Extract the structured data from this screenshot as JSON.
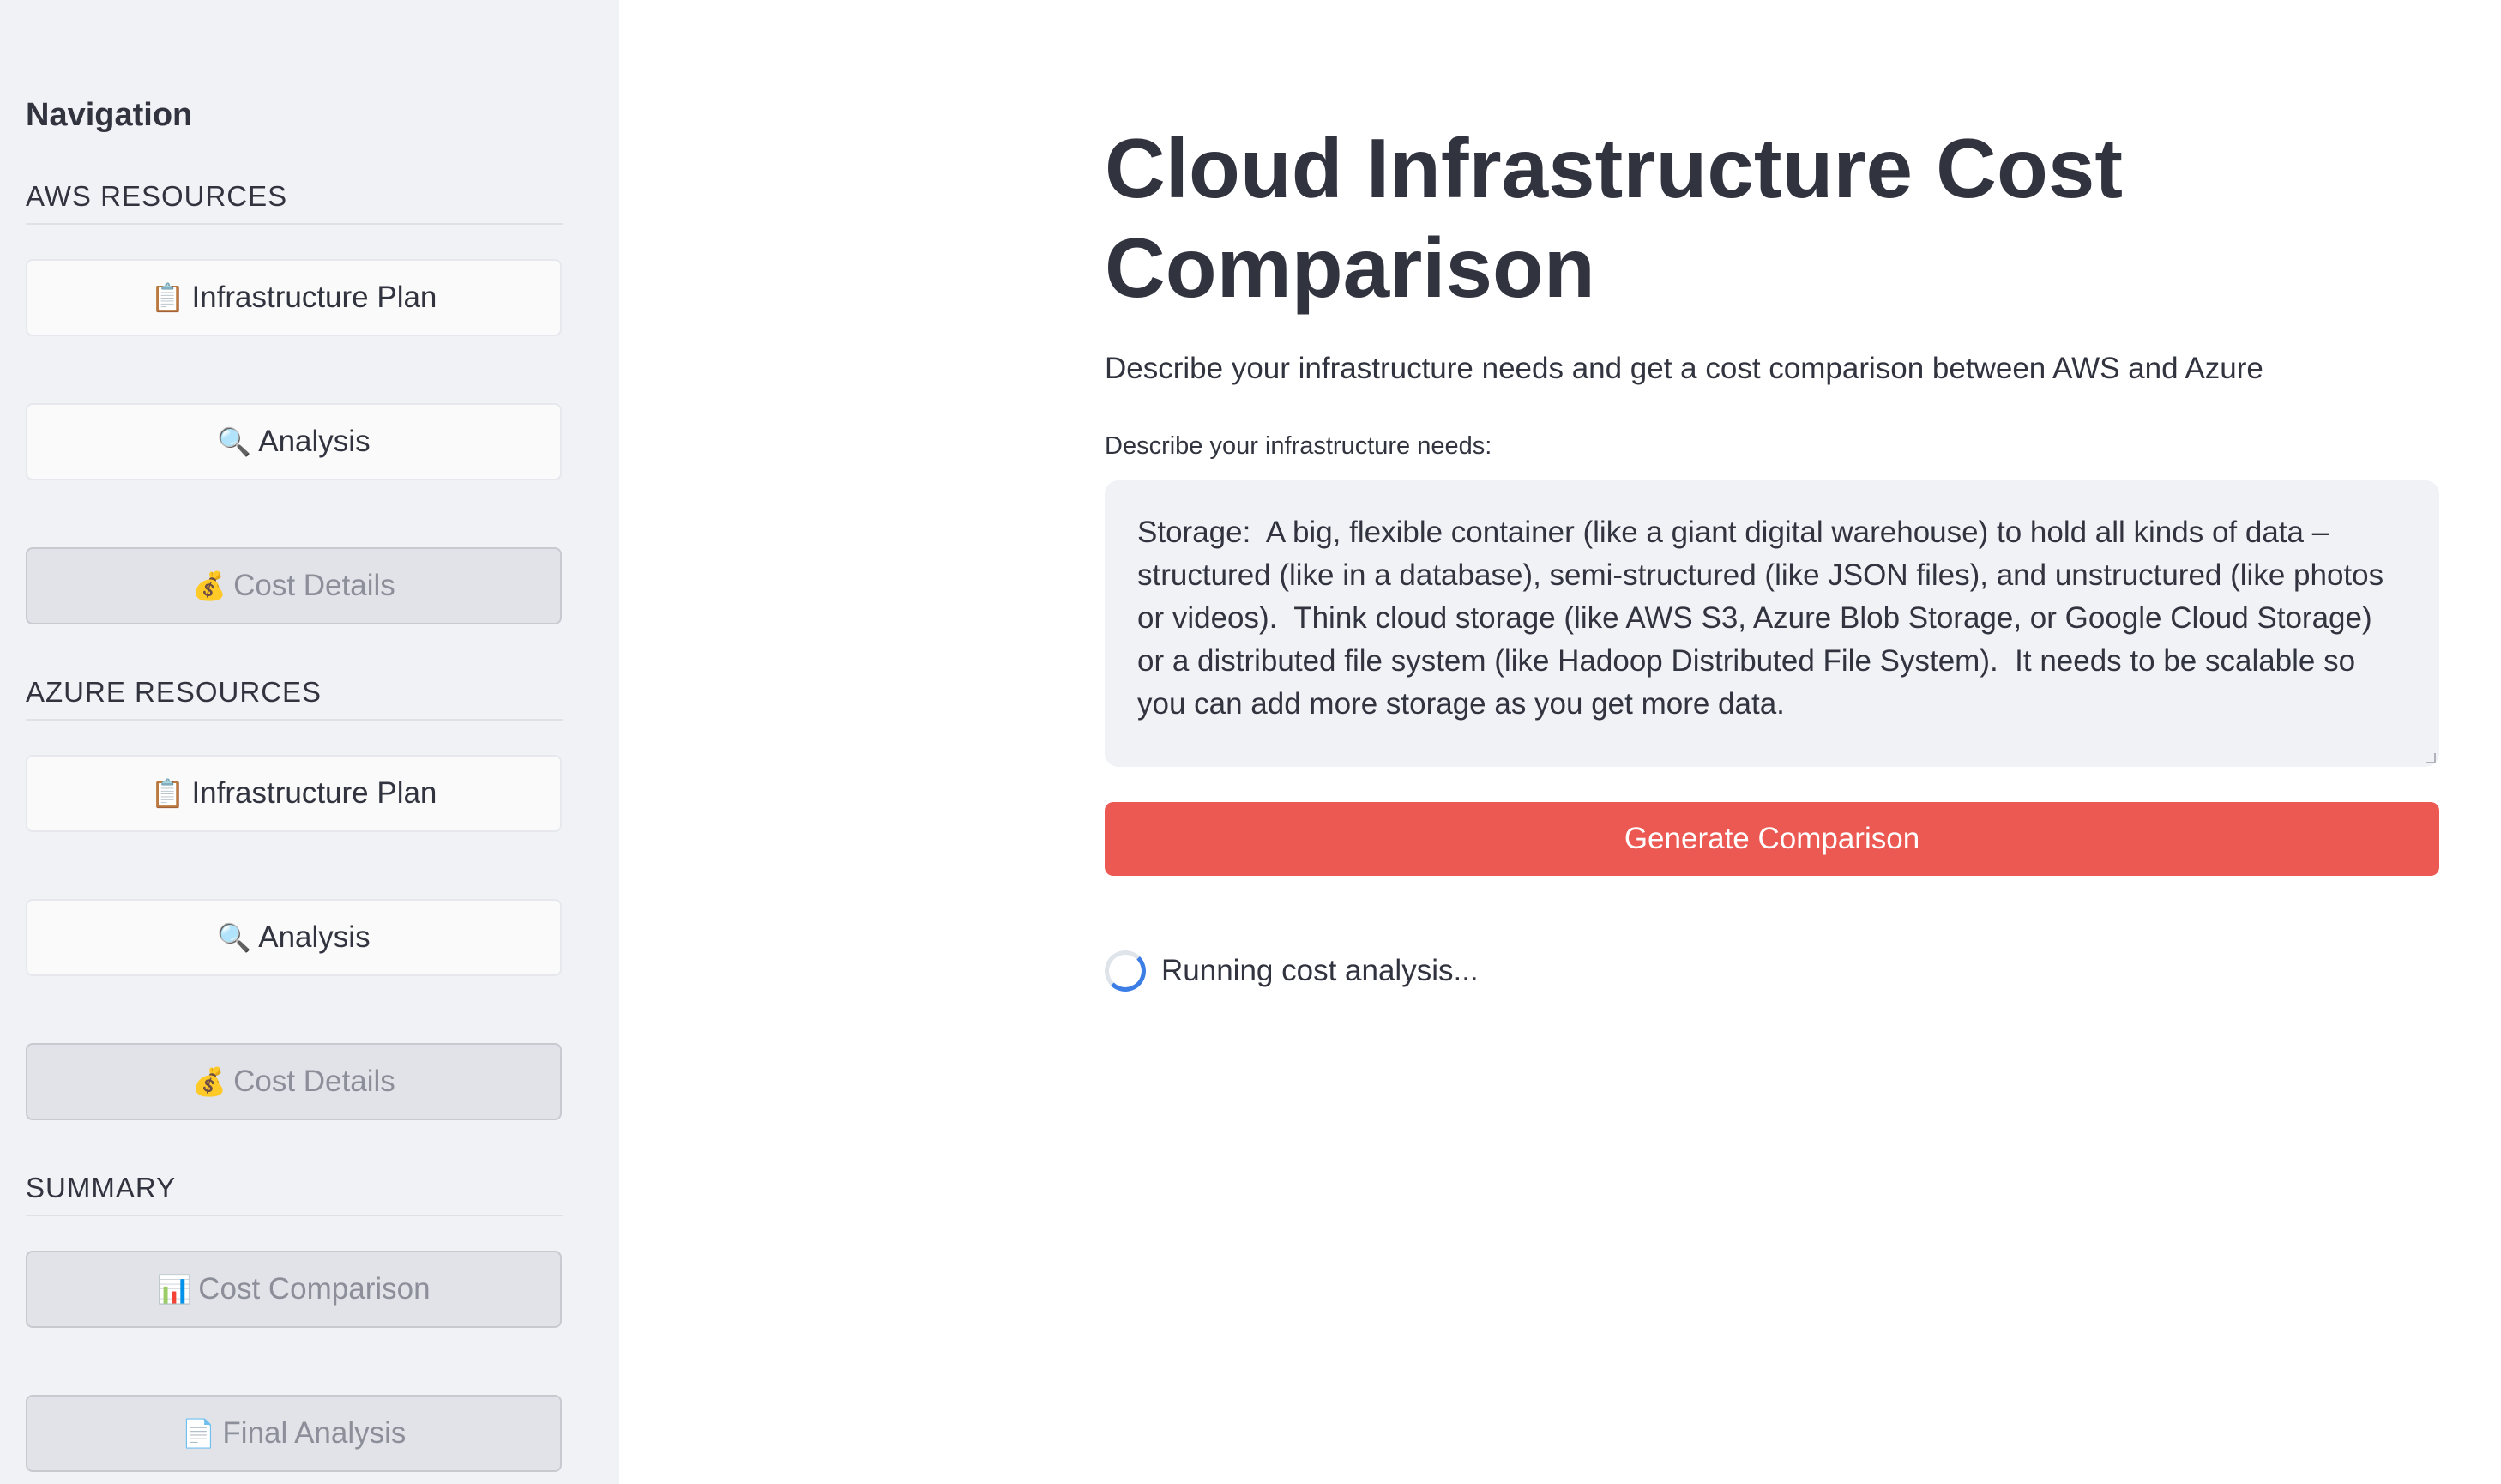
{
  "sidebar": {
    "title": "Navigation",
    "sections": [
      {
        "header": "AWS RESOURCES",
        "buttons": [
          {
            "icon": "📋",
            "label": "Infrastructure Plan"
          },
          {
            "icon": "🔍",
            "label": "Analysis"
          },
          {
            "icon": "💰",
            "label": "Cost Details"
          }
        ]
      },
      {
        "header": "AZURE RESOURCES",
        "buttons": [
          {
            "icon": "📋",
            "label": "Infrastructure Plan"
          },
          {
            "icon": "🔍",
            "label": "Analysis"
          },
          {
            "icon": "💰",
            "label": "Cost Details"
          }
        ]
      },
      {
        "header": "SUMMARY",
        "buttons": [
          {
            "icon": "📊",
            "label": "Cost Comparison"
          },
          {
            "icon": "📄",
            "label": "Final Analysis"
          }
        ]
      }
    ]
  },
  "main": {
    "title": "Cloud Infrastructure Cost Comparison",
    "subtitle": "Describe your infrastructure needs and get a cost comparison between AWS and Azure",
    "input_label": "Describe your infrastructure needs:",
    "input_value": "Storage:  A big, flexible container (like a giant digital warehouse) to hold all kinds of data – structured (like in a database), semi-structured (like JSON files), and unstructured (like photos or videos).  Think cloud storage (like AWS S3, Azure Blob Storage, or Google Cloud Storage) or a distributed file system (like Hadoop Distributed File System).  It needs to be scalable so you can add more storage as you get more data.",
    "generate_label": "Generate Comparison",
    "status_text": "Running cost analysis..."
  }
}
